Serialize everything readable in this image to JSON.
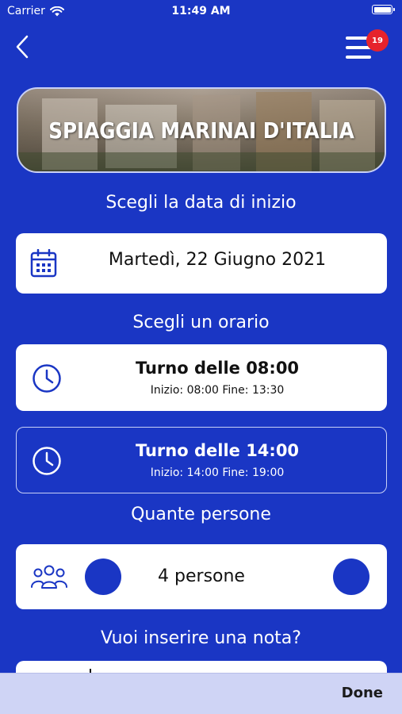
{
  "status_bar": {
    "carrier": "Carrier",
    "time": "11:49 AM"
  },
  "header": {
    "notification_count": "19"
  },
  "banner": {
    "title": "SPIAGGIA MARINAI D'ITALIA"
  },
  "date_section": {
    "title": "Scegli la data di inizio",
    "selected_date": "Martedì, 22 Giugno 2021"
  },
  "time_section": {
    "title": "Scegli un orario",
    "shifts": [
      {
        "title": "Turno delle 08:00",
        "detail": "Inizio: 08:00 Fine: 13:30",
        "selected": true
      },
      {
        "title": "Turno delle 14:00",
        "detail": "Inizio: 14:00 Fine: 19:00",
        "selected": false
      }
    ]
  },
  "people_section": {
    "title": "Quante persone",
    "value": "4 persone"
  },
  "note_section": {
    "title": "Vuoi inserire una nota?"
  },
  "keyboard_toolbar": {
    "done_label": "Done"
  },
  "colors": {
    "background": "#1a36c4",
    "badge": "#e6232c",
    "card": "#ffffff"
  }
}
